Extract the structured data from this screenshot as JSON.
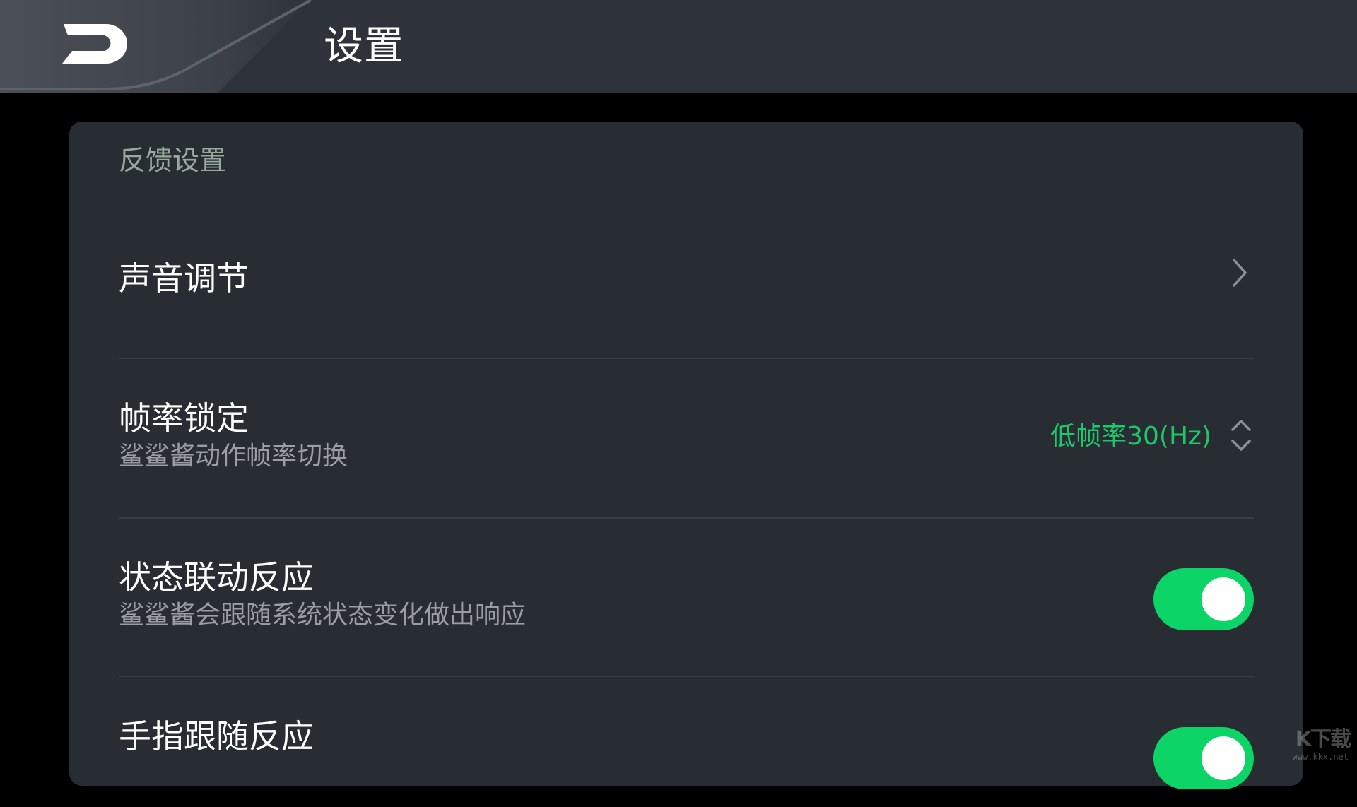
{
  "header": {
    "title": "设置"
  },
  "section": {
    "title": "反馈设置"
  },
  "rows": [
    {
      "title": "声音调节",
      "control": "chevron-right-icon"
    },
    {
      "title": "帧率锁定",
      "subtitle": "鲨鲨酱动作帧率切换",
      "value": "低帧率30(Hz)",
      "control": "up-down-arrows-icon"
    },
    {
      "title": "状态联动反应",
      "subtitle": "鲨鲨酱会跟随系统状态变化做出响应",
      "toggle_on": true
    },
    {
      "title": "手指跟随反应",
      "toggle_on": true
    }
  ],
  "colors": {
    "header_bg": "#2e333b",
    "card_bg": "#282c33",
    "accent_green": "#0dd466",
    "value_green": "#1ec76a",
    "section_title": "#97a89c"
  },
  "watermark": {
    "main": "K下载",
    "url": "www.kkx.net"
  }
}
